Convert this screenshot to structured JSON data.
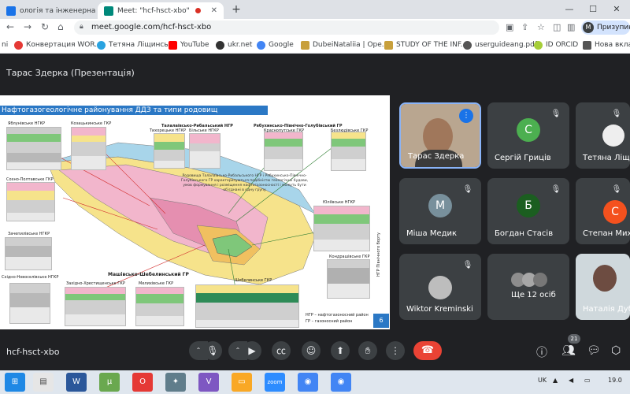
{
  "browser": {
    "tabs": [
      {
        "label": "ологія та інженерна геол",
        "favicon_color": "#1a73e8"
      },
      {
        "label": "Meet: \"hcf-hsct-xbo\"",
        "favicon_color": "#00897b"
      }
    ],
    "new_tab_label": "+",
    "window_controls": {
      "minimize": "—",
      "maximize": "☐",
      "close": "✕"
    },
    "address": "meet.google.com/hcf-hsct-xbo",
    "profile_initial": "M",
    "profile_label": "Призупинено",
    "bookmarks": [
      {
        "label": "ni",
        "color": "#888888"
      },
      {
        "label": "Конвертация WOR...",
        "color": "#e53935"
      },
      {
        "label": "Тетяна Ліщинська",
        "color": "#2aa3e0"
      },
      {
        "label": "YouTube",
        "color": "#ff0000"
      },
      {
        "label": "ukr.net",
        "color": "#333333"
      },
      {
        "label": "Google",
        "color": "#4285f4"
      },
      {
        "label": "DubeiNataliia | Ope...",
        "color": "#c8a03c"
      },
      {
        "label": "STUDY OF THE INF...",
        "color": "#c8a03c"
      },
      {
        "label": "userguideang.pdf",
        "color": "#555555"
      },
      {
        "label": "ID ORCID",
        "color": "#a6ce39"
      },
      {
        "label": "Нова вкладка",
        "color": "#555555"
      }
    ]
  },
  "meet": {
    "presenter_title": "Тарас Здерка (Презентація)",
    "meeting_code": "hcf-hsct-xbo",
    "participants_count": "21",
    "participants": [
      {
        "name": "Тарас Здерка",
        "initial": "",
        "color": "#8d6e63",
        "video": true
      },
      {
        "name": "Сергій Гриців",
        "initial": "С",
        "color": "#4caf50",
        "video": false
      },
      {
        "name": "Тетяна Ліщинська",
        "initial": "",
        "color": "#eeeeee",
        "video": true
      },
      {
        "name": "Міша Медик",
        "initial": "М",
        "color": "#78909c",
        "video": false
      },
      {
        "name": "Богдан Стасів",
        "initial": "Б",
        "color": "#1b5e20",
        "video": false
      },
      {
        "name": "Степан Михайлович",
        "initial": "С",
        "color": "#f4511e",
        "video": false
      },
      {
        "name": "Wiktor Kreminski",
        "initial": "",
        "color": "#bdbdbd",
        "video": true
      },
      {
        "name": "Ще 12 осіб",
        "initial": "",
        "color": "#5f6368",
        "video": false
      },
      {
        "name": "Наталія Дубей",
        "initial": "",
        "color": "#cfd8dc",
        "video": true
      }
    ]
  },
  "slide": {
    "title": "Нафтогазогеологічне районування ДДЗ та типи родовищ",
    "labels": {
      "yabluniv": "Яблунівське НГКР",
      "kozach": "Козацькинське ГКР",
      "tuapl": "Талалаївсько-Рибальський НГР",
      "tekh": "Тихорецьке НГКР",
      "bilsk": "Більське НГКР",
      "rybuh": "Рябухинсько-Північно-Голубівський ГР",
      "krasnoput": "Краснопутське ГКР",
      "bezlud": "Безлюдівське ГКР",
      "sokhpolt": "Сохно-Полтавське ГКР",
      "yuliiv": "Юліївське НГКР",
      "kondr": "Кондрашівське ГКР",
      "zachepil": "Зачепилівське НГКР",
      "skhnov": "Східно-Новоселівське НГКР",
      "mashiv": "Машівсько-Шебелинський ГР",
      "zakh": "Західно-Хрестищенське ГКР",
      "melikh": "Мелихівське ГКР",
      "shebel": "Шебелинське ГКР",
      "side": "НГР Північного борту",
      "legend1": "НГР – нафтогазоносний район",
      "legend2": "ГР – газоносний район",
      "annotation": "Родовища Талалаївсько-Рибальського НГР і Рябухинсько-Північно-Голубівського ГР характеризуються подібністю геологічної будови, умов формування і розміщення нафтогазоносності і можуть бути об’єднані в одну групу"
    },
    "page": "6"
  },
  "taskbar": {
    "apps": [
      {
        "label": "⊞",
        "color": "#1e88e5"
      },
      {
        "label": "W",
        "color": "#2b579a"
      },
      {
        "label": "μ",
        "color": "#6aa84f"
      },
      {
        "label": "O",
        "color": "#e53935"
      },
      {
        "label": "✦",
        "color": "#607d8b"
      },
      {
        "label": "V",
        "color": "#7e57c2"
      },
      {
        "label": "▭",
        "color": "#f9a825"
      },
      {
        "label": "zoom",
        "color": "#2d8cff"
      },
      {
        "label": "◉",
        "color": "#e8eaed"
      },
      {
        "label": "◉",
        "color": "#e8eaed"
      }
    ],
    "lang": "UK",
    "clock": "19.0"
  },
  "colors": {
    "accent": "#1a73e8",
    "end_call": "#ea4335",
    "meet_bg": "#202124",
    "tile_bg": "#3c4043"
  }
}
